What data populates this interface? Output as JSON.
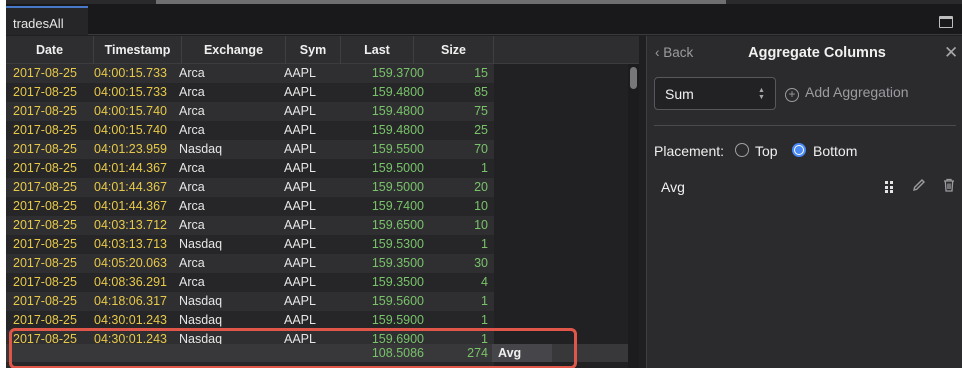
{
  "tab": {
    "title": "tradesAll"
  },
  "columns": [
    "Date",
    "Timestamp",
    "Exchange",
    "Sym",
    "Last",
    "Size"
  ],
  "rows": [
    [
      "2017-08-25",
      "04:00:15.733",
      "Arca",
      "AAPL",
      "159.3700",
      "15"
    ],
    [
      "2017-08-25",
      "04:00:15.733",
      "Arca",
      "AAPL",
      "159.4800",
      "85"
    ],
    [
      "2017-08-25",
      "04:00:15.740",
      "Arca",
      "AAPL",
      "159.4800",
      "75"
    ],
    [
      "2017-08-25",
      "04:00:15.740",
      "Arca",
      "AAPL",
      "159.4800",
      "25"
    ],
    [
      "2017-08-25",
      "04:01:23.959",
      "Nasdaq",
      "AAPL",
      "159.5500",
      "70"
    ],
    [
      "2017-08-25",
      "04:01:44.367",
      "Arca",
      "AAPL",
      "159.5000",
      "1"
    ],
    [
      "2017-08-25",
      "04:01:44.367",
      "Arca",
      "AAPL",
      "159.5000",
      "20"
    ],
    [
      "2017-08-25",
      "04:01:44.367",
      "Arca",
      "AAPL",
      "159.7400",
      "10"
    ],
    [
      "2017-08-25",
      "04:03:13.712",
      "Arca",
      "AAPL",
      "159.6500",
      "10"
    ],
    [
      "2017-08-25",
      "04:03:13.713",
      "Nasdaq",
      "AAPL",
      "159.5300",
      "1"
    ],
    [
      "2017-08-25",
      "04:05:20.063",
      "Arca",
      "AAPL",
      "159.3500",
      "30"
    ],
    [
      "2017-08-25",
      "04:08:36.291",
      "Arca",
      "AAPL",
      "159.3500",
      "4"
    ],
    [
      "2017-08-25",
      "04:18:06.317",
      "Nasdaq",
      "AAPL",
      "159.5600",
      "1"
    ],
    [
      "2017-08-25",
      "04:30:01.243",
      "Nasdaq",
      "AAPL",
      "159.5900",
      "1"
    ],
    [
      "2017-08-25",
      "04:30:01.243",
      "Nasdaq",
      "AAPL",
      "159.6900",
      "1"
    ]
  ],
  "aggregate_row": {
    "last": "108.5086",
    "size": "274",
    "label": "Avg"
  },
  "panel": {
    "back_label": "Back",
    "title": "Aggregate Columns",
    "operation_select": "Sum",
    "add_aggregation": "Add Aggregation",
    "placement_label": "Placement:",
    "placement_options": [
      "Top",
      "Bottom"
    ],
    "placement_selected": "Bottom",
    "aggregations": [
      {
        "name": "Avg"
      }
    ]
  },
  "icons": [
    "maximize-icon",
    "chevron-left-icon",
    "close-icon",
    "select-arrows-icon",
    "add-circle-icon",
    "drag-handle-icon",
    "edit-icon",
    "trash-icon"
  ],
  "colors": {
    "date_text": "#e7c94a",
    "number_text": "#79c36a",
    "accent": "#4a8af4",
    "highlight": "#e0574a"
  }
}
